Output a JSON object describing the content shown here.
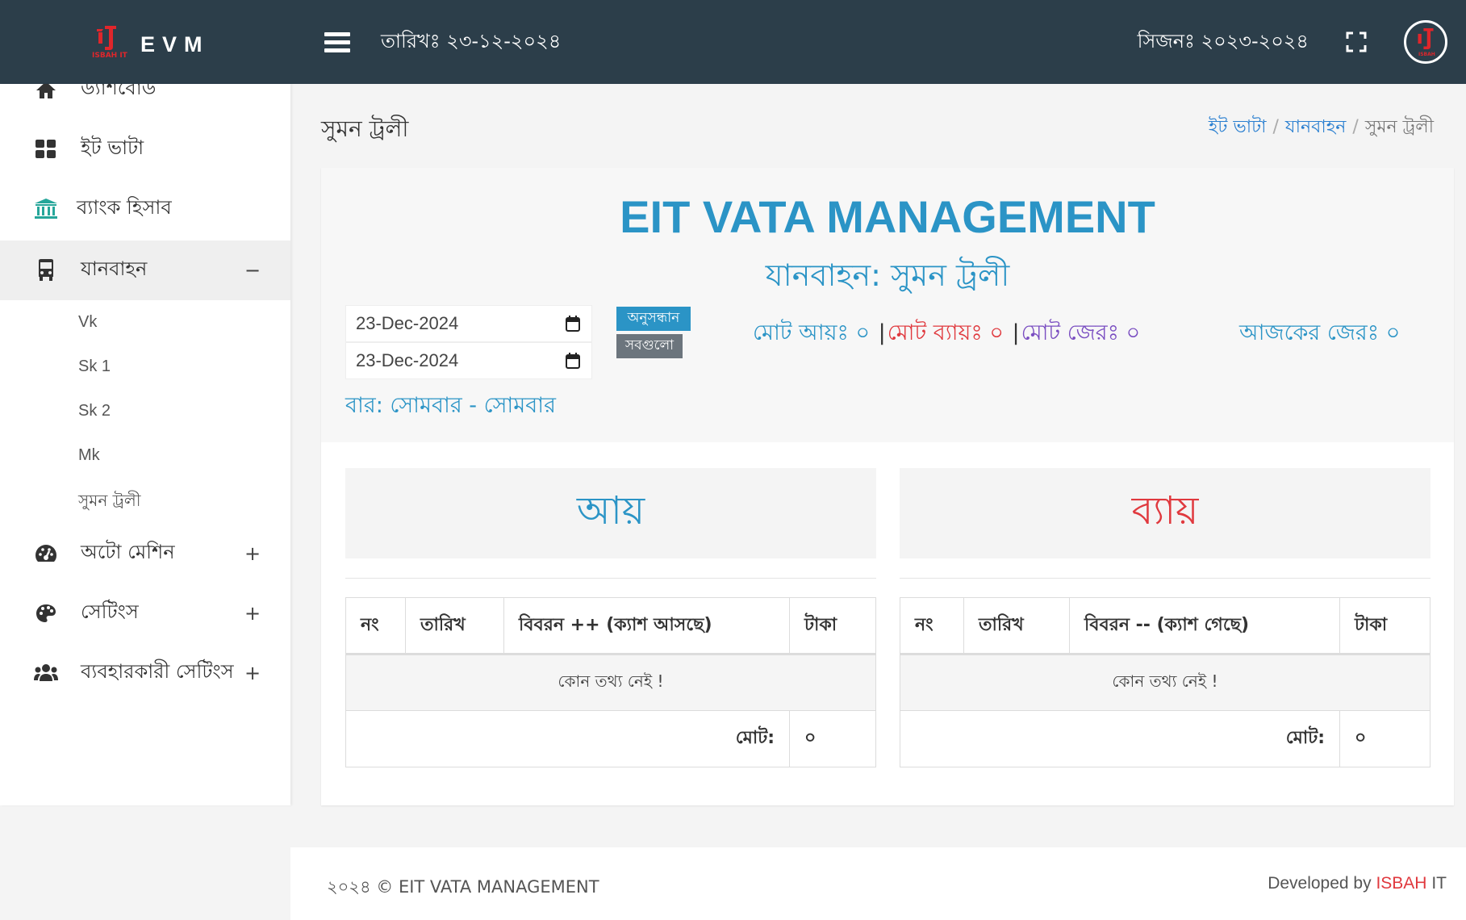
{
  "header": {
    "brand_name": "EVM",
    "brand_logo_sub": "ISBAH IT",
    "date": "তারিখঃ ২৩-১২-২০২৪",
    "season": "সিজনঃ ২০২৩-২০২৪",
    "avatar_sub": "ISBAH"
  },
  "sidebar": {
    "items": [
      {
        "label": "ড্যাশবোর্ড",
        "icon": "home-icon"
      },
      {
        "label": "ইট ভাটা",
        "icon": "grid-icon"
      },
      {
        "label": "ব্যাংক হিসাব",
        "icon": "bank-icon"
      },
      {
        "label": "যানবাহন",
        "icon": "bus-icon",
        "toggle": "−"
      },
      {
        "label": "অটো মেশিন",
        "icon": "gauge-icon",
        "toggle": "+"
      },
      {
        "label": "সেটিংস",
        "icon": "palette-icon",
        "toggle": "+"
      },
      {
        "label": "ব্যবহারকারী সেটিংস",
        "icon": "users-icon",
        "toggle": "+"
      }
    ],
    "vehicles": [
      "Vk",
      "Sk 1",
      "Sk 2",
      "Mk",
      "সুমন ট্রলী"
    ]
  },
  "page": {
    "title": "সুমন ট্রলী",
    "breadcrumb": [
      "ইট ভাটা",
      "যানবাহন",
      "সুমন ট্রলী"
    ]
  },
  "report": {
    "title": "EIT VATA MANAGEMENT",
    "subtitle": "যানবাহন: সুমন ট্রলী",
    "date_from": "23-Dec-2024",
    "date_to": "23-Dec-2024",
    "search_label": "অনুসন্ধান",
    "all_label": "সবগুলো",
    "day_range": "বার: সোমবার - সোমবার",
    "total_income": "মোট আয়ঃ ০",
    "total_expense": "মোট ব্যায়ঃ ০",
    "total_balance": "মোট জেরঃ ০",
    "separator": "|",
    "today_balance": "আজকের জেরঃ ০"
  },
  "income": {
    "heading": "আয়",
    "columns": [
      "নং",
      "তারিখ",
      "বিবরন ++ (ক্যাশ আসছে)",
      "টাকা"
    ],
    "empty": "কোন তথ্য নেই !",
    "total_label": "মোট:",
    "total_value": "০"
  },
  "expense": {
    "heading": "ব্যায়",
    "columns": [
      "নং",
      "তারিখ",
      "বিবরন -- (ক্যাশ গেছে)",
      "টাকা"
    ],
    "empty": "কোন তথ্য নেই !",
    "total_label": "মোট:",
    "total_value": "০"
  },
  "footer": {
    "copyright": "২০২৪ © EIT VATA MANAGEMENT",
    "developed_by": "Developed by",
    "dev_brand": "ISBAH",
    "dev_suffix": "IT"
  },
  "colors": {
    "topbar": "#2c3e4a",
    "accent_blue": "#2b94c6",
    "expense_red": "#e0393e",
    "balance_purple": "#7a4ec1",
    "logo_red": "#e0262b"
  }
}
